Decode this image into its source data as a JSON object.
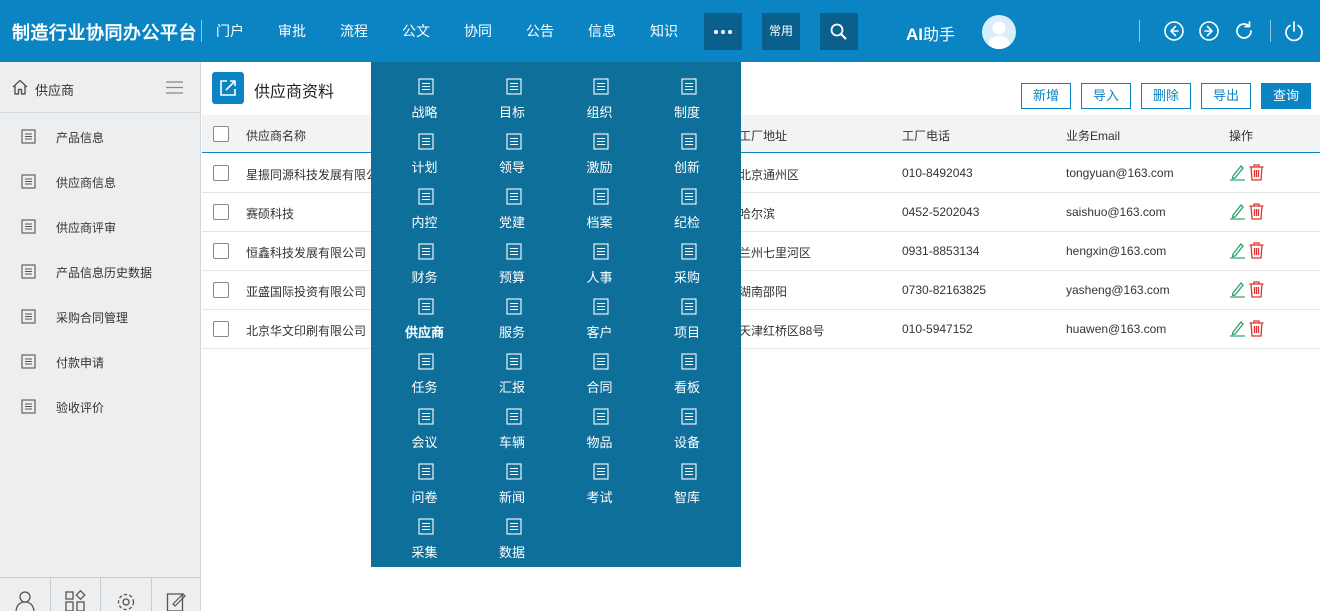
{
  "app": {
    "title": "制造行业协同办公平台"
  },
  "nav": [
    "门户",
    "审批",
    "流程",
    "公文",
    "协同",
    "公告",
    "信息",
    "知识"
  ],
  "topbar": {
    "common_label": "常用",
    "ai_label_prefix": "AI",
    "ai_label_suffix": "助手"
  },
  "sidebar": {
    "title": "供应商",
    "items": [
      "产品信息",
      "供应商信息",
      "供应商评审",
      "产品信息历史数据",
      "采购合同管理",
      "付款申请",
      "验收评价"
    ]
  },
  "page": {
    "title": "供应商资料",
    "buttons": {
      "add": "新增",
      "import": "导入",
      "delete": "删除",
      "export": "导出",
      "query": "查询"
    }
  },
  "table": {
    "headers": [
      "供应商名称",
      "工厂地址",
      "工厂电话",
      "业务Email",
      "操作"
    ],
    "rows": [
      {
        "name": "星振同源科技发展有限公司",
        "address": "北京通州区",
        "phone": "010-8492043",
        "email": "tongyuan@163.com"
      },
      {
        "name": "赛硕科技",
        "address": "哈尔滨",
        "phone": "0452-5202043",
        "email": "saishuo@163.com"
      },
      {
        "name": "恒鑫科技发展有限公司",
        "address": "兰州七里河区",
        "phone": "0931-8853134",
        "email": "hengxin@163.com"
      },
      {
        "name": "亚盛国际投资有限公司",
        "address": "湖南邵阳",
        "phone": "0730-82163825",
        "email": "yasheng@163.com"
      },
      {
        "name": "北京华文印刷有限公司",
        "address": "天津红桥区88号",
        "phone": "010-5947152",
        "email": "huawen@163.com"
      }
    ]
  },
  "menu": {
    "active": "供应商",
    "items": [
      "战略",
      "目标",
      "组织",
      "制度",
      "计划",
      "领导",
      "激励",
      "创新",
      "内控",
      "党建",
      "档案",
      "纪检",
      "财务",
      "预算",
      "人事",
      "采购",
      "供应商",
      "服务",
      "客户",
      "项目",
      "任务",
      "汇报",
      "合同",
      "看板",
      "会议",
      "车辆",
      "物品",
      "设备",
      "问卷",
      "新闻",
      "考试",
      "智库",
      "采集",
      "数据"
    ]
  },
  "colors": {
    "primary": "#0a84c2",
    "menu_bg": "#0e6f9b",
    "edit": "#2aa36b",
    "delete": "#e0322e"
  }
}
